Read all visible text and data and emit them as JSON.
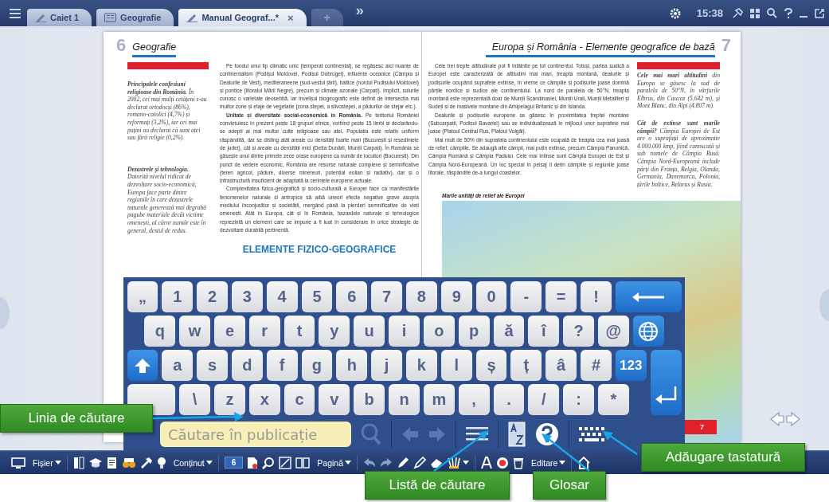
{
  "top_bar": {
    "tabs": [
      {
        "kind": "notebook",
        "label": "Caiet 1",
        "selected": false
      },
      {
        "kind": "book",
        "label": "Geografie",
        "selected": false
      },
      {
        "kind": "notebook",
        "label": "Manual Geograf...*",
        "selected": true,
        "close": "×"
      }
    ],
    "new_tab": "+",
    "more": "»",
    "time": "15:38"
  },
  "left_page": {
    "page_number": "6",
    "title": "Geografie",
    "notes": [
      "**Principalele confesiuni religioase din România.** În 2002, cei mai mulți cetățeni s-au declarat ortodocși (86%), romano-catolici (4,7%) și reformați (3,2%), iar cei mai puțini au declarat că sunt atei sau fără religie (0,2%).",
      "**Dezastrele și tehnologia.** Datorită nivelul ridicat de dezvoltare socio-economică, Europa face parte dintre regiunile în care dezastrele naturale generează mai degrabă pagube materiale decât victime omenești, al căror număr este în general, destul de redus."
    ],
    "paragraphs": [
      "Pe fondul unui tip climatic unic (temperat continental), se regăsesc aici nuanțe de continentalism (Podișul Moldovei, Podișul Dobrogei), influențe oceanice (Câmpia și Dealurile de Vest), mediteraneene (sud-vestul țării), baltice (nordul Podișului Moldovei) și pontice (litoralul Mării Negre), precum și climate azonale (Carpați). Implicit, solurile cunosc o varietate deosebită, iar învelișul biogeografic este definit de intersecția mai multor zone și etaje de vegetație (zona stepei, a silvostepei, a pădurilor de stejar etc.).",
      "**Unitate și diversitate social-economică în România.** Pe teritoriul României conviețuiesc în prezent peste 18 grupuri etnice, vorbind peste 15 limbi și declarându-se adepți ai mai multor culte religioase sau atei. Populația este relativ uniform răspândită, dar se disting atât areale cu densități foarte mari (București și reședințele de județ), cât și areale cu densități mici (Delta Dunării, Munții Carpați). În România se găsește unul dintre primele zece orașe europene ca număr de locuitori (București). Din punct de vedere economic, România are resurse naturale complexe și semnificative (teren agricol, pădure, diverse minereuri, potențial eolian și radiativ), dar și o infrastructură insuficient de adaptată la cerințele europene actuale.",
      "Complexitatea fizico-geografică și socio-culturală a Europei face ca manifestările fenomenelor naturale și antropice să aibă uneori efecte negative grave asupra mediului înconjurător și societății, mergând până la pierderi semnificative de vieți omenești. Atât în Europa, cât și în România, hazardele naturale și tehnologice reprezintă un element care se impune a fi luat în considerare în orice strategie de dezvoltare durabilă pertinentă."
    ],
    "heading": "ELEMENTE FIZICO-GEOGRAFICE"
  },
  "right_page": {
    "page_number": "7",
    "title": "Europa și România - Elemente geografice de bază",
    "paragraphs": [
      "Cele trei trepte altitudinale pot fi întâlnite pe tot continentul. Totuși, partea sudică a Europei este caracterizată de altitudini mai mari, treapta montană, dealurile și podișurile ocupând suprafețe extinse, în vreme ce câmpiile și podișurile joase domină părțile nordice și sudice ale continentului. La nord de paralela de 50°N, treapta montană este reprezentată doar de Munții Scandinaviei, Munții Urali, Munții Metaliferi și Sudeți și de masivele montane din Arhipelagul Britanic și din Islanda.",
      "Dealurile și podișurile europene se găsesc în proximitatea treptei montane (Subcarpații, Podișul Bavariei) sau se individualizează în mijlocul unor suprafețe mai joase (Platoul Central Rus, Platoul Volgăi).",
      "Mai mult de 50% din suprafața continentului este ocupată de treapta cea mai joasă de relief, câmpiile. Se adaugă alte câmpii, mai puțin extinse, precum Câmpia Panonică, Câmpia Română și Câmpia Padului. Cele mai întinse sunt Câmpia Europei de Est și Câmpia Nord-Europeană. Un loc special în peisaj îl dețin câmpiile și regiunile joase litorale, răspândite de-a lungul coastelor."
    ],
    "notes": [
      "**Cele mai mari altitudini** din Europa se găsesc la sud de paralela de 50°N, în vârfurile Elbrus, din Caucaz (5.642 m), și Mont Blanc, din Alpi (4.807 m).",
      "**Cât de extinse sunt marile câmpii?** Câmpia Europei de Est are o suprafață de aproximativ 4.000.000 kmp, fiind cunoscută și sub numele de Câmpia Rusă. Câmpia Nord-Europeană include părți din Franța, Belgia, Olanda, Germania, Danemarca, Polonia, țările baltice, Belarus și Rusia."
    ],
    "map_caption": "Marile unități de relief ale Europei",
    "footer_page_number": "7"
  },
  "keyboard": {
    "rows": [
      [
        {
          "kind": "char",
          "label": "„"
        },
        {
          "kind": "char",
          "label": "1"
        },
        {
          "kind": "char",
          "label": "2"
        },
        {
          "kind": "char",
          "label": "3"
        },
        {
          "kind": "char",
          "label": "4"
        },
        {
          "kind": "char",
          "label": "5"
        },
        {
          "kind": "char",
          "label": "6"
        },
        {
          "kind": "char",
          "label": "7"
        },
        {
          "kind": "char",
          "label": "8"
        },
        {
          "kind": "char",
          "label": "9"
        },
        {
          "kind": "char",
          "label": "0"
        },
        {
          "kind": "char",
          "label": "-"
        },
        {
          "kind": "char",
          "label": "="
        },
        {
          "kind": "char",
          "label": "!"
        },
        {
          "kind": "backspace"
        }
      ],
      [
        {
          "kind": "char",
          "label": "q"
        },
        {
          "kind": "char",
          "label": "w"
        },
        {
          "kind": "char",
          "label": "e"
        },
        {
          "kind": "char",
          "label": "r"
        },
        {
          "kind": "char",
          "label": "t"
        },
        {
          "kind": "char",
          "label": "y"
        },
        {
          "kind": "char",
          "label": "u"
        },
        {
          "kind": "char",
          "label": "i"
        },
        {
          "kind": "char",
          "label": "o"
        },
        {
          "kind": "char",
          "label": "p"
        },
        {
          "kind": "char",
          "label": "ă"
        },
        {
          "kind": "char",
          "label": "î"
        },
        {
          "kind": "char",
          "label": "?"
        },
        {
          "kind": "char",
          "label": "@"
        },
        {
          "kind": "globe"
        }
      ],
      [
        {
          "kind": "shift"
        },
        {
          "kind": "char",
          "label": "a"
        },
        {
          "kind": "char",
          "label": "s"
        },
        {
          "kind": "char",
          "label": "d"
        },
        {
          "kind": "char",
          "label": "f"
        },
        {
          "kind": "char",
          "label": "g"
        },
        {
          "kind": "char",
          "label": "h"
        },
        {
          "kind": "char",
          "label": "j"
        },
        {
          "kind": "char",
          "label": "k"
        },
        {
          "kind": "char",
          "label": "l"
        },
        {
          "kind": "char",
          "label": "ș"
        },
        {
          "kind": "char",
          "label": "ț"
        },
        {
          "kind": "char",
          "label": "â"
        },
        {
          "kind": "char",
          "label": "#"
        },
        {
          "kind": "numbers",
          "label": "123"
        },
        {
          "kind": "enter"
        }
      ],
      [
        {
          "kind": "blank"
        },
        {
          "kind": "char",
          "label": "\\"
        },
        {
          "kind": "char",
          "label": "z"
        },
        {
          "kind": "char",
          "label": "x"
        },
        {
          "kind": "char",
          "label": "c"
        },
        {
          "kind": "char",
          "label": "v"
        },
        {
          "kind": "char",
          "label": "b"
        },
        {
          "kind": "char",
          "label": "n"
        },
        {
          "kind": "char",
          "label": "m"
        },
        {
          "kind": "char",
          "label": ","
        },
        {
          "kind": "char",
          "label": "."
        },
        {
          "kind": "char",
          "label": "/"
        },
        {
          "kind": "char",
          "label": ":"
        },
        {
          "kind": "char",
          "label": "*"
        }
      ]
    ],
    "search": {
      "placeholder": "Căutare în publicație"
    }
  },
  "toolbar": {
    "menus": [
      "Fișier",
      "Conținut",
      "Pagină",
      "Editare"
    ],
    "page_field": "6"
  },
  "callouts": [
    "Linia de căutare",
    "Listă de căutare",
    "Glosar",
    "Adăugare tastatură"
  ]
}
